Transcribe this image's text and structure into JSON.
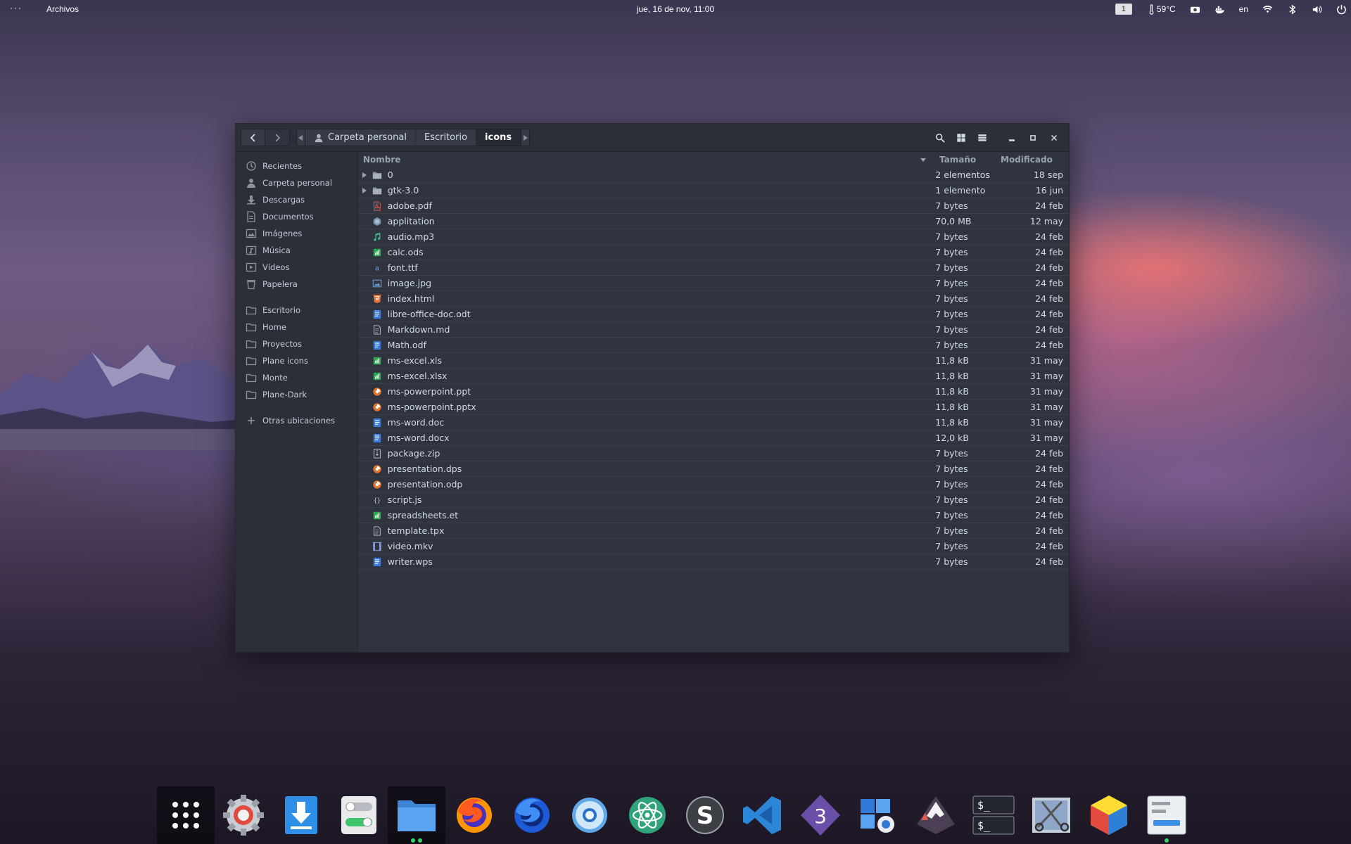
{
  "topbar": {
    "menu_dots": "···",
    "app_name": "Archivos",
    "clock": "jue, 16 de nov, 11:00",
    "workspace": "1",
    "temperature": "59°C",
    "language": "en",
    "icons": [
      "thermometer-icon",
      "camera-icon",
      "docker-icon",
      "wifi-icon",
      "bluetooth-icon",
      "volume-icon",
      "power-icon"
    ]
  },
  "headerbar": {
    "path": [
      "Carpeta personal",
      "Escritorio",
      "icons"
    ],
    "icons": [
      "back-icon",
      "forward-icon",
      "search-icon",
      "grid-view-icon",
      "menu-icon",
      "minimize-icon",
      "maximize-icon",
      "close-icon"
    ]
  },
  "sidebar": {
    "places": [
      {
        "label": "Recientes",
        "icon": "recent-icon"
      },
      {
        "label": "Carpeta personal",
        "icon": "home-icon"
      },
      {
        "label": "Descargas",
        "icon": "downloads-icon"
      },
      {
        "label": "Documentos",
        "icon": "documents-icon"
      },
      {
        "label": "Imágenes",
        "icon": "pictures-icon"
      },
      {
        "label": "Música",
        "icon": "music-icon"
      },
      {
        "label": "Vídeos",
        "icon": "videos-icon"
      },
      {
        "label": "Papelera",
        "icon": "trash-icon"
      }
    ],
    "bookmarks": [
      {
        "label": "Escritorio",
        "icon": "folder-icon"
      },
      {
        "label": "Home",
        "icon": "folder-icon"
      },
      {
        "label": "Proyectos",
        "icon": "folder-icon"
      },
      {
        "label": "Plane icons",
        "icon": "folder-icon"
      },
      {
        "label": "Monte",
        "icon": "folder-icon"
      },
      {
        "label": "Plane-Dark",
        "icon": "folder-icon"
      }
    ],
    "other_locations": "Otras ubicaciones"
  },
  "filelist": {
    "columns": {
      "name": "Nombre",
      "size": "Tamaño",
      "modified": "Modificado"
    },
    "rows": [
      {
        "name": "0",
        "size": "2 elementos",
        "modified": "18 sep",
        "type": "folder",
        "expandable": true
      },
      {
        "name": "gtk-3.0",
        "size": "1 elemento",
        "modified": "16 jun",
        "type": "folder",
        "expandable": true
      },
      {
        "name": "adobe.pdf",
        "size": "7 bytes",
        "modified": "24 feb",
        "type": "pdf"
      },
      {
        "name": "applitation",
        "size": "70,0 MB",
        "modified": "12 may",
        "type": "app"
      },
      {
        "name": "audio.mp3",
        "size": "7 bytes",
        "modified": "24 feb",
        "type": "audio"
      },
      {
        "name": "calc.ods",
        "size": "7 bytes",
        "modified": "24 feb",
        "type": "sheet"
      },
      {
        "name": "font.ttf",
        "size": "7 bytes",
        "modified": "24 feb",
        "type": "font"
      },
      {
        "name": "image.jpg",
        "size": "7 bytes",
        "modified": "24 feb",
        "type": "image"
      },
      {
        "name": "index.html",
        "size": "7 bytes",
        "modified": "24 feb",
        "type": "html"
      },
      {
        "name": "libre-office-doc.odt",
        "size": "7 bytes",
        "modified": "24 feb",
        "type": "doc"
      },
      {
        "name": "Markdown.md",
        "size": "7 bytes",
        "modified": "24 feb",
        "type": "text"
      },
      {
        "name": "Math.odf",
        "size": "7 bytes",
        "modified": "24 feb",
        "type": "doc"
      },
      {
        "name": "ms-excel.xls",
        "size": "11,8 kB",
        "modified": "31 may",
        "type": "sheet"
      },
      {
        "name": "ms-excel.xlsx",
        "size": "11,8 kB",
        "modified": "31 may",
        "type": "sheet"
      },
      {
        "name": "ms-powerpoint.ppt",
        "size": "11,8 kB",
        "modified": "31 may",
        "type": "presentation"
      },
      {
        "name": "ms-powerpoint.pptx",
        "size": "11,8 kB",
        "modified": "31 may",
        "type": "presentation"
      },
      {
        "name": "ms-word.doc",
        "size": "11,8 kB",
        "modified": "31 may",
        "type": "doc"
      },
      {
        "name": "ms-word.docx",
        "size": "12,0 kB",
        "modified": "31 may",
        "type": "doc"
      },
      {
        "name": "package.zip",
        "size": "7 bytes",
        "modified": "24 feb",
        "type": "archive"
      },
      {
        "name": "presentation.dps",
        "size": "7 bytes",
        "modified": "24 feb",
        "type": "presentation"
      },
      {
        "name": "presentation.odp",
        "size": "7 bytes",
        "modified": "24 feb",
        "type": "presentation"
      },
      {
        "name": "script.js",
        "size": "7 bytes",
        "modified": "24 feb",
        "type": "script"
      },
      {
        "name": "spreadsheets.et",
        "size": "7 bytes",
        "modified": "24 feb",
        "type": "sheet"
      },
      {
        "name": "template.tpx",
        "size": "7 bytes",
        "modified": "24 feb",
        "type": "text"
      },
      {
        "name": "video.mkv",
        "size": "7 bytes",
        "modified": "24 feb",
        "type": "video"
      },
      {
        "name": "writer.wps",
        "size": "7 bytes",
        "modified": "24 feb",
        "type": "doc"
      }
    ]
  },
  "dock": {
    "apps": [
      {
        "icon": "app-grid-icon",
        "active": true,
        "running": 0
      },
      {
        "icon": "settings-icon",
        "running": 0
      },
      {
        "icon": "download-manager-icon",
        "running": 0
      },
      {
        "icon": "tweaks-icon",
        "running": 0
      },
      {
        "icon": "files-icon",
        "active": true,
        "running": 2
      },
      {
        "icon": "firefox-icon",
        "running": 0
      },
      {
        "icon": "firefox-nightly-icon",
        "running": 0
      },
      {
        "icon": "chrome-icon",
        "running": 0
      },
      {
        "icon": "atom-icon",
        "running": 0
      },
      {
        "icon": "sublime-icon",
        "running": 0
      },
      {
        "icon": "vscode-icon",
        "running": 0
      },
      {
        "icon": "blender3-icon",
        "running": 0
      },
      {
        "icon": "screenshot-icon",
        "running": 0
      },
      {
        "icon": "inkscape-icon",
        "running": 0
      },
      {
        "icon": "terminal-icon",
        "running": 0
      },
      {
        "icon": "screenshot-tool-icon",
        "running": 0
      },
      {
        "icon": "cube-icon",
        "running": 0
      },
      {
        "icon": "glade-icon",
        "running": 1
      }
    ]
  },
  "colors": {
    "window_bg": "#2f343f",
    "sidebar_bg": "#2b2f38",
    "text": "#d3dae3",
    "running_dot": "#38d26a"
  }
}
